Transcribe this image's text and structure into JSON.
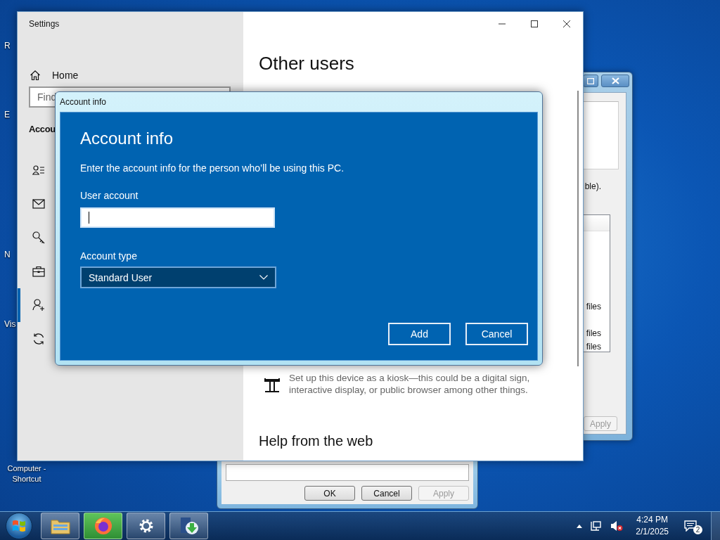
{
  "desktop_icons": [
    {
      "label": "R"
    },
    {
      "label": "E"
    },
    {
      "label": "N"
    },
    {
      "label": "Vis"
    },
    {
      "label": "Computer - Shortcut"
    }
  ],
  "properties_window": {
    "partial_text": "ble).",
    "list_items": [
      "files",
      "files",
      "files"
    ],
    "buttons": [
      {
        "label": "Apply",
        "disabled": true
      }
    ]
  },
  "lower_dialog": {
    "buttons": [
      {
        "label": "OK",
        "disabled": false
      },
      {
        "label": "Cancel",
        "disabled": false
      },
      {
        "label": "Apply",
        "disabled": true
      }
    ]
  },
  "settings_window": {
    "title": "Settings",
    "home": "Home",
    "search": {
      "placeholder": "Find"
    },
    "section": "Accou",
    "nav_items": [
      {
        "selected": false
      },
      {
        "selected": false
      },
      {
        "selected": false
      },
      {
        "selected": false
      },
      {
        "selected": true
      },
      {
        "selected": false
      }
    ],
    "heading": "Other users",
    "kiosk_description": "Set up this device as a kiosk—this could be a digital sign, interactive display, or public browser among other things.",
    "help_heading": "Help from the web"
  },
  "dialog": {
    "title": "Account info",
    "heading": "Account info",
    "description": "Enter the account info for the person who’ll be using this PC.",
    "user_account": {
      "label": "User account",
      "focused": true
    },
    "account_type": {
      "label": "Account type",
      "value": "Standard User"
    },
    "buttons": [
      {
        "label": "Add"
      },
      {
        "label": "Cancel"
      }
    ]
  },
  "taskbar": {
    "time": "4:24 PM",
    "date": "2/1/2025",
    "notification_count": "2"
  }
}
